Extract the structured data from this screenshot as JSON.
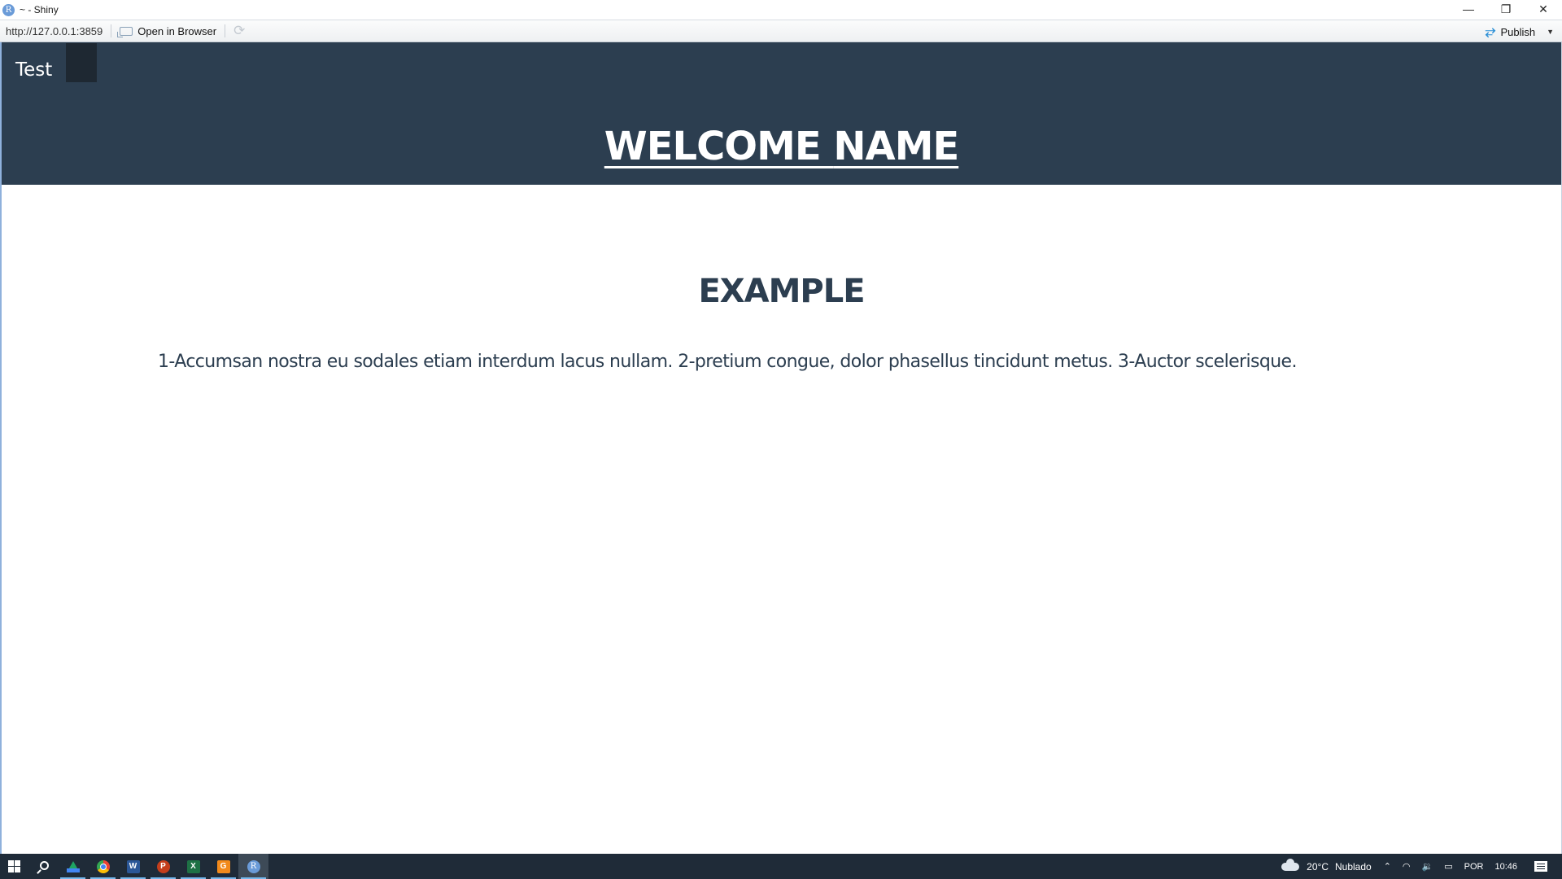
{
  "window": {
    "title": "~ - Shiny",
    "app_icon_letter": "R",
    "controls": {
      "minimize": "—",
      "restore": "❐",
      "close": "✕"
    }
  },
  "toolbar": {
    "url": "http://127.0.0.1:3859",
    "open_in_browser_label": "Open in Browser",
    "refresh_icon": "⟳",
    "publish_label": "Publish",
    "publish_icon": "⥂",
    "publish_caret": "▼"
  },
  "navbar": {
    "brand": "Test",
    "welcome_prefix": "WELCOME ",
    "welcome_name": "NAME",
    "background_color": "#2c3e50"
  },
  "main": {
    "section_title": "EXAMPLE",
    "paragraph": "1-Accumsan nostra eu sodales etiam interdum lacus nullam. 2-pretium congue, dolor phasellus tincidunt metus. 3-Auctor scelerisque.",
    "text_color": "#2c3e50"
  },
  "taskbar": {
    "apps": [
      {
        "name": "start",
        "label": ""
      },
      {
        "name": "search",
        "label": ""
      },
      {
        "name": "google-drive",
        "label": ""
      },
      {
        "name": "chrome",
        "label": ""
      },
      {
        "name": "word",
        "label": "W"
      },
      {
        "name": "powerpoint",
        "label": "P"
      },
      {
        "name": "excel",
        "label": "X"
      },
      {
        "name": "app-g",
        "label": "G"
      },
      {
        "name": "rstudio",
        "label": "R"
      }
    ],
    "tray": {
      "temperature": "20°C",
      "weather": "Nublado",
      "chevron": "⌃",
      "wifi": "◠",
      "volume": "🔉",
      "battery": "▭",
      "language": "POR",
      "time": "10:46"
    }
  }
}
